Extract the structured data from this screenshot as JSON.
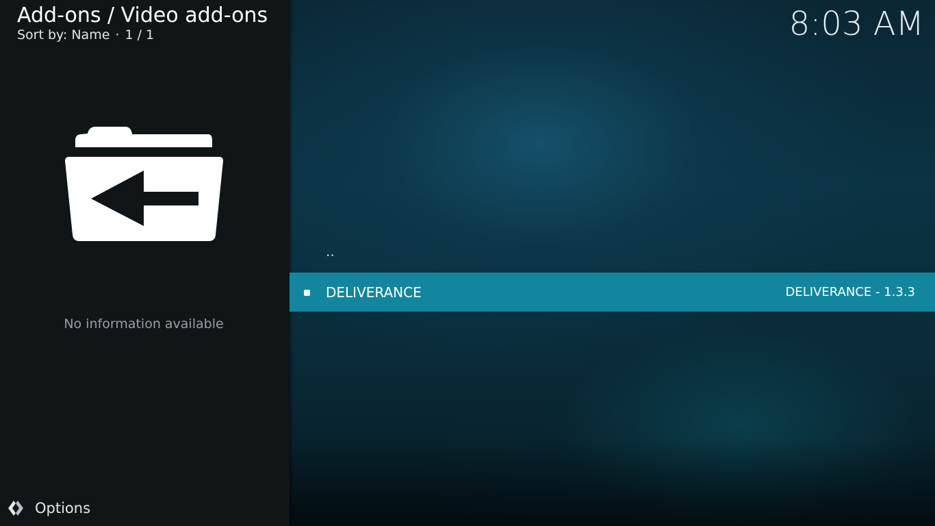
{
  "header": {
    "title": "Add-ons / Video add-ons",
    "sort_label": "Sort by: Name",
    "separator": "·",
    "page_count": "1 / 1"
  },
  "clock": {
    "time": "8:03 AM"
  },
  "info_panel": {
    "icon": "folder-back-icon",
    "message": "No information available"
  },
  "footer": {
    "options_icon": "options-icon",
    "options_label": "Options"
  },
  "list": {
    "items": [
      {
        "label": "..",
        "type": "parent"
      },
      {
        "label": "DELIVERANCE",
        "detail": "DELIVERANCE - 1.3.3",
        "selected": true
      }
    ]
  },
  "colors": {
    "selection": "#12869f",
    "panel_bg": "#101518",
    "muted_text": "#9a9fa2"
  }
}
